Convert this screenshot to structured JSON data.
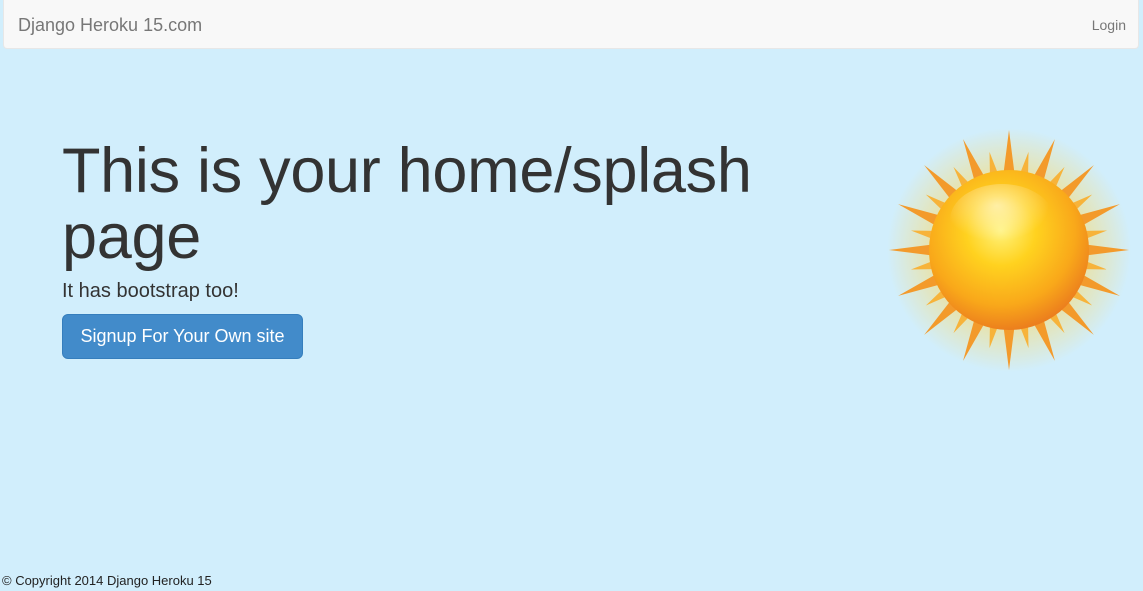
{
  "navbar": {
    "brand": "Django Heroku 15.com",
    "login_label": "Login"
  },
  "hero": {
    "title": "This is your home/splash page",
    "subtitle": "It has bootstrap too!",
    "signup_label": "Signup For Your Own site"
  },
  "illustration": {
    "icon": "sun-icon"
  },
  "footer": {
    "copyright": "© Copyright 2014 Django Heroku 15"
  },
  "colors": {
    "background": "#d1eefc",
    "navbar": "#f8f8f8",
    "primary_button": "#428bca",
    "sun_core": "#fbb81b",
    "sun_rays": "#f08c2a"
  }
}
